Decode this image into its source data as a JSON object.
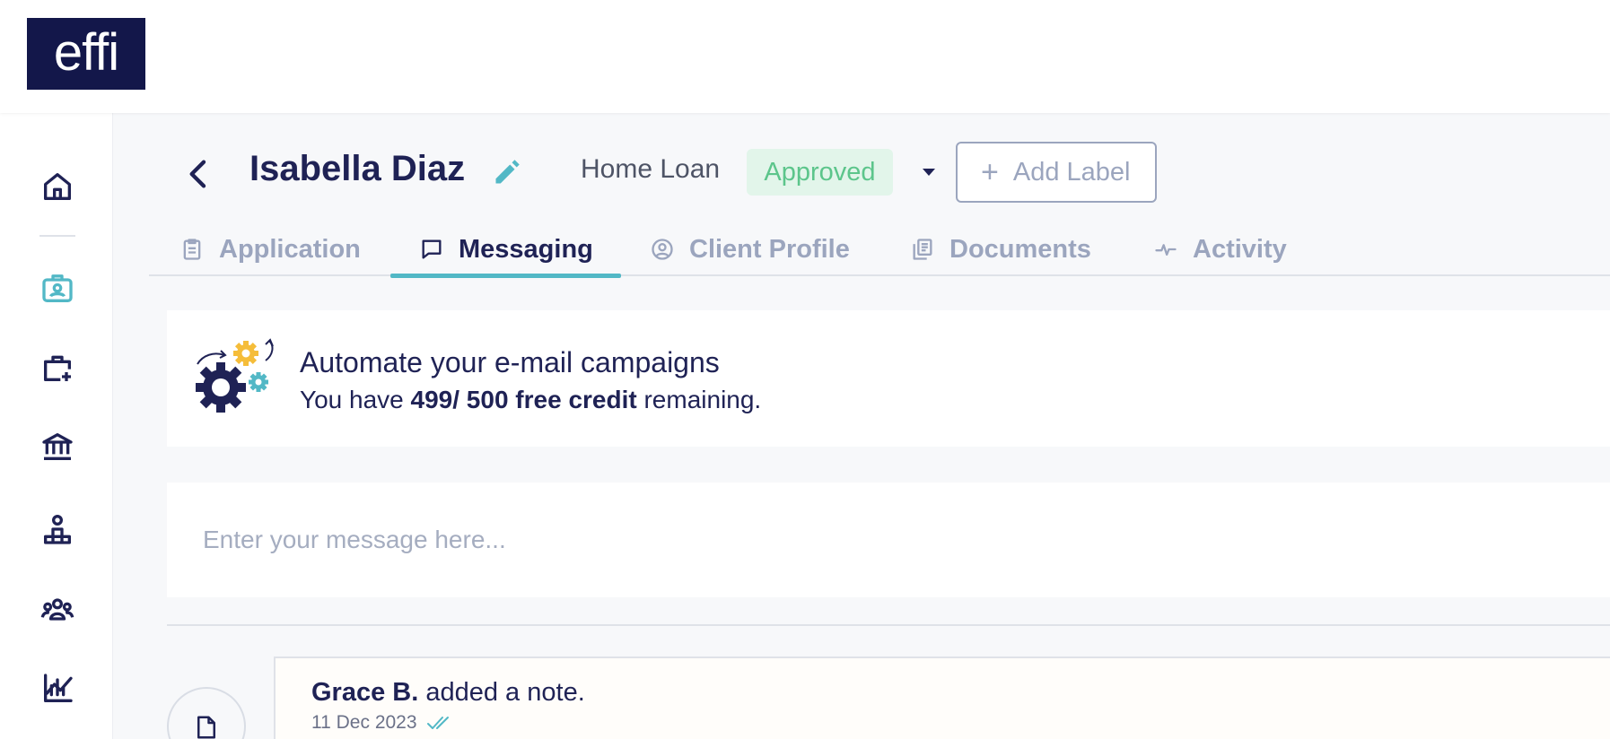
{
  "app": {
    "logo_text": "effi"
  },
  "sidebar": {
    "items": [
      {
        "name": "home",
        "icon": "home-icon"
      },
      {
        "name": "clients",
        "icon": "contact-card-icon",
        "active": true
      },
      {
        "name": "new-deal",
        "icon": "briefcase-plus-icon"
      },
      {
        "name": "lenders",
        "icon": "bank-icon"
      },
      {
        "name": "referrers",
        "icon": "person-stand-icon"
      },
      {
        "name": "team",
        "icon": "team-icon"
      },
      {
        "name": "reports",
        "icon": "chart-icon"
      }
    ]
  },
  "header": {
    "client_name": "Isabella Diaz",
    "loan_type": "Home Loan",
    "status": "Approved",
    "add_label": "Add Label",
    "add_label_plus": "+"
  },
  "tabs": [
    {
      "label": "Application",
      "icon": "clipboard-icon"
    },
    {
      "label": "Messaging",
      "icon": "chat-icon",
      "active": true
    },
    {
      "label": "Client Profile",
      "icon": "user-circle-icon"
    },
    {
      "label": "Documents",
      "icon": "documents-icon"
    },
    {
      "label": "Activity",
      "icon": "activity-icon"
    }
  ],
  "promo": {
    "title": "Automate your e-mail campaigns",
    "sub_prefix": "You have ",
    "credit": "499/ 500 free credit",
    "sub_suffix": " remaining."
  },
  "composer": {
    "placeholder": "Enter your message here..."
  },
  "timeline": [
    {
      "author": "Grace B.",
      "action": "added a",
      "object": "note.",
      "date": "11 Dec 2023"
    }
  ],
  "colors": {
    "navy": "#1f2255",
    "accent": "#52b8c6",
    "approved_text": "#5cc58b",
    "approved_bg": "#e2f5ea",
    "muted": "#9ba5be",
    "gear_yellow": "#f5bd3a"
  }
}
